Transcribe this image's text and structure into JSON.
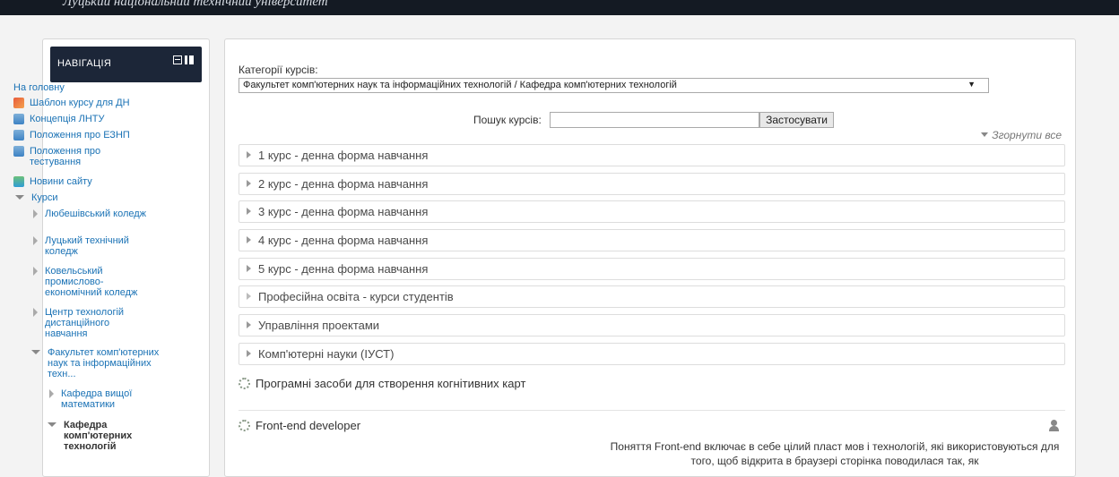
{
  "header": {
    "title": "Луцький національний технічний університет"
  },
  "nav": {
    "title": "НАВІГАЦІЯ",
    "home": "На головну",
    "items": [
      {
        "label": "Шаблон курсу для ДН",
        "icon": "pdf-icon"
      },
      {
        "label": "Концепція ЛНТУ",
        "icon": "document-icon"
      },
      {
        "label": "Положення про ЕЗНП",
        "icon": "document-icon"
      },
      {
        "label": "Положення про тестування",
        "icon": "document-icon"
      },
      {
        "label": "Новини сайту",
        "icon": "news-icon"
      }
    ],
    "courses": "Курси",
    "course_items": [
      "Любешівський коледж",
      "Луцький технічний коледж",
      "Ковельський промислово-економічний коледж",
      "Центр технологій дистанційного навчання",
      "Факультет комп'ютерних наук та інформаційних техн..."
    ],
    "faculty_children": [
      "Кафедра вищої математики",
      "Кафедра комп'ютерних технологій"
    ]
  },
  "main": {
    "category_label": "Категорії курсів:",
    "category_selected": "Факультет комп'ютерних наук та інформаційних технологій / Кафедра комп'ютерних технологій",
    "search_label": "Пошук курсів:",
    "search_value": "",
    "search_button": "Застосувати",
    "collapse_all": "Згорнути все",
    "categories": [
      "1 курс - денна форма навчання",
      "2 курс - денна форма навчання",
      "3 курс - денна форма навчання",
      "4 курс - денна форма навчання",
      "5 курс - денна форма навчання",
      "Професійна освіта - курси студентів",
      "Управління проектами",
      "Комп'ютерні науки (ІУСТ)"
    ],
    "courses": [
      {
        "title": "Програмні засоби для створення когнітивних карт"
      },
      {
        "title": "Front-end developer",
        "summary": "Поняття Front-end включає в себе цілий пласт мов і технологій, які використовуються для того, щоб відкрита в браузері сторінка поводилася так, як"
      }
    ]
  }
}
